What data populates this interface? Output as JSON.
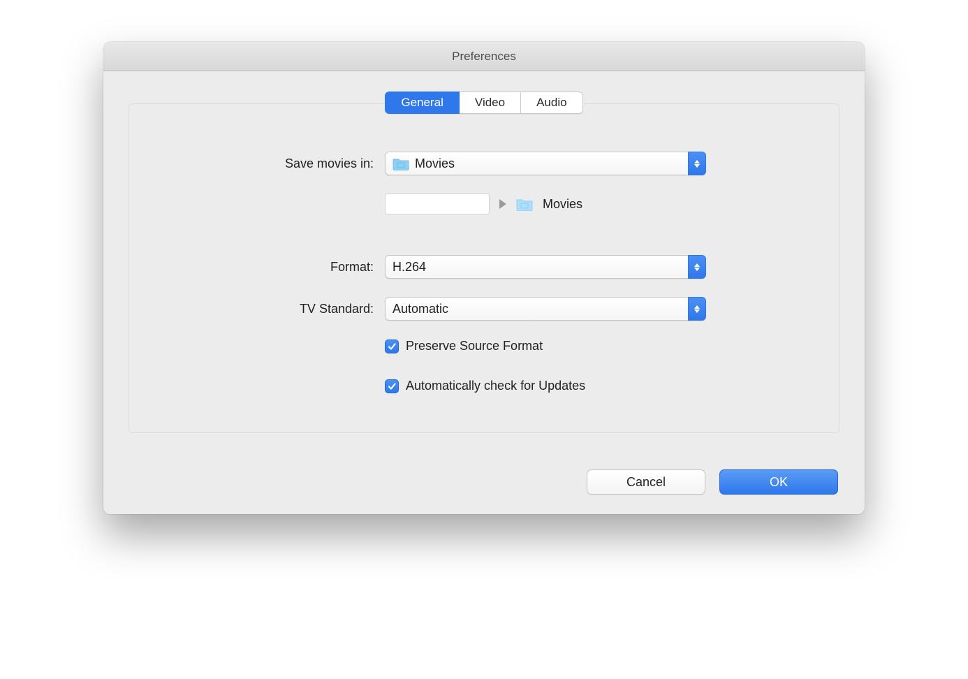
{
  "window": {
    "title": "Preferences"
  },
  "tabs": {
    "general": "General",
    "video": "Video",
    "audio": "Audio",
    "active": "general"
  },
  "labels": {
    "save_movies_in": "Save movies in:",
    "format": "Format:",
    "tv_standard": "TV Standard:"
  },
  "values": {
    "save_location": "Movies",
    "breadcrumb_folder": "Movies",
    "format": "H.264",
    "tv_standard": "Automatic"
  },
  "checkboxes": {
    "preserve_source_format": {
      "label": "Preserve Source Format",
      "checked": true
    },
    "auto_check_updates": {
      "label": "Automatically check for Updates",
      "checked": true
    }
  },
  "buttons": {
    "cancel": "Cancel",
    "ok": "OK"
  },
  "icons": {
    "folder": "folder-icon"
  },
  "colors": {
    "accent": "#2f78ec"
  }
}
